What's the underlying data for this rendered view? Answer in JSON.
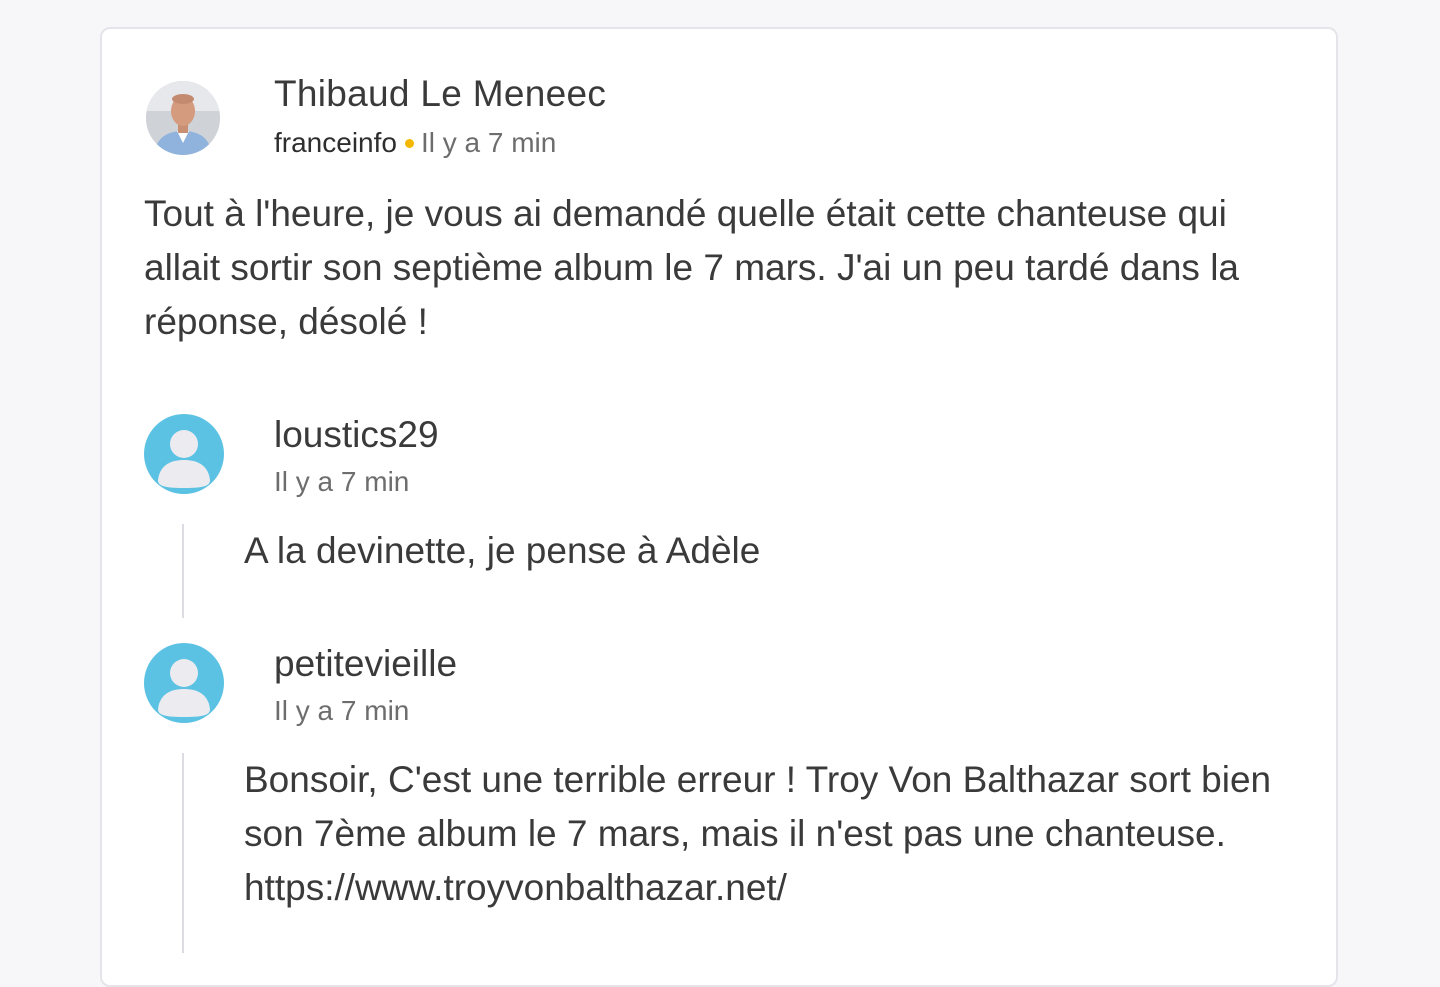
{
  "post": {
    "author": "Thibaud Le Meneec",
    "source": "franceinfo",
    "time": "Il y a 7 min",
    "body": "Tout à l'heure, je vous ai demandé quelle était cette chanteuse qui allait sortir son septième album le 7 mars. J'ai un peu tardé dans la réponse, désolé !"
  },
  "comments": [
    {
      "username": "loustics29",
      "time": "Il y a 7 min",
      "text": "A la devinette, je pense à Adèle"
    },
    {
      "username": "petitevieille",
      "time": "Il y a 7 min",
      "text": "Bonsoir, C'est une terrible erreur ! Troy Von Balthazar sort bien son 7ème album le 7 mars, mais il n'est pas une chanteuse. https://www.troyvonbalthazar.net/"
    }
  ],
  "colors": {
    "accent_dot": "#f5b800",
    "default_avatar": "#5bc2e3",
    "card_border": "#e4e4ea"
  },
  "icons": {
    "author_avatar": "author-photo-avatar",
    "user_avatar": "default-user-avatar-icon"
  }
}
